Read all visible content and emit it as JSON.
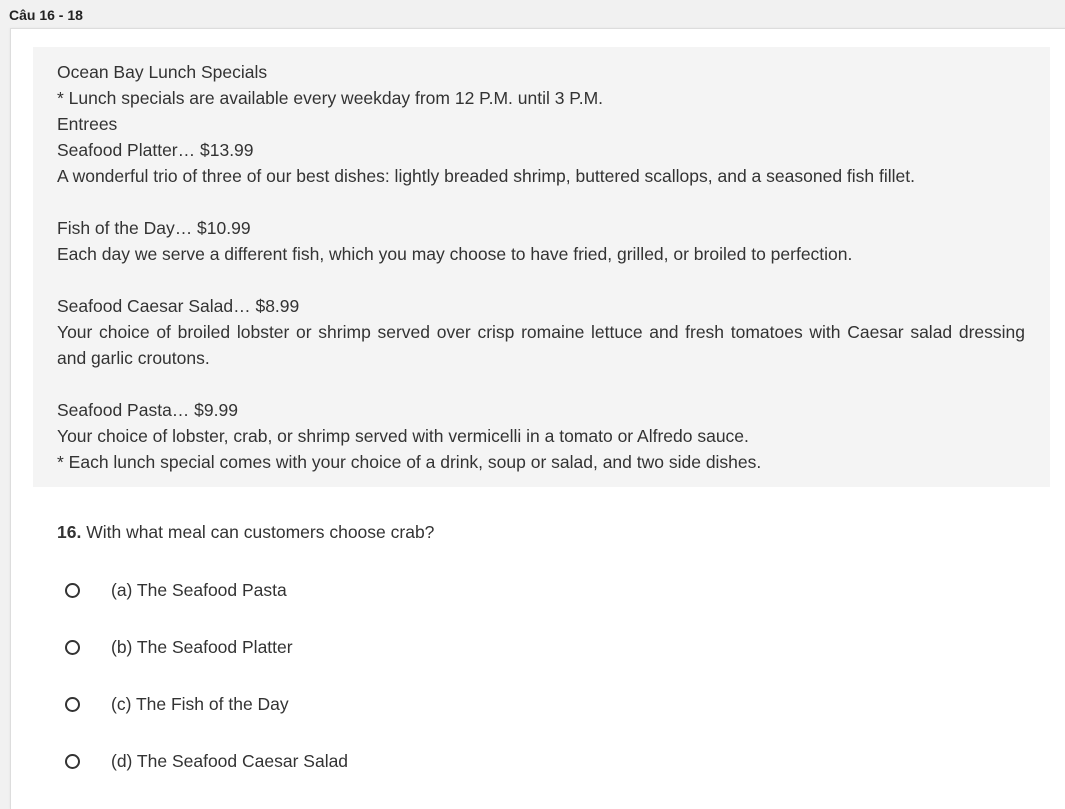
{
  "header": {
    "title": "Câu 16 - 18"
  },
  "passage": {
    "lines": [
      "Ocean Bay Lunch Specials",
      "* Lunch specials are available every weekday from 12 P.M. until 3 P.M.",
      "Entrees",
      "Seafood Platter… $13.99",
      "A wonderful trio of three of our best dishes: lightly breaded shrimp, buttered scallops, and a seasoned fish fillet.",
      "Fish of the Day… $10.99",
      "Each day we serve a different fish, which you may choose to have fried, grilled, or broiled to perfection.",
      "Seafood Caesar Salad… $8.99",
      "Your choice of broiled lobster or shrimp served over crisp romaine lettuce and fresh tomatoes with Caesar salad dressing and garlic croutons.",
      "Seafood Pasta… $9.99",
      "Your choice of lobster, crab, or shrimp served with vermicelli in a tomato or Alfredo sauce.",
      "* Each lunch special comes with your choice of a drink, soup or salad, and two side dishes."
    ]
  },
  "question": {
    "number": "16.",
    "text": "With what meal can customers choose crab?",
    "options": [
      {
        "label": "(a) The Seafood Pasta",
        "selected": false
      },
      {
        "label": "(b) The Seafood Platter",
        "selected": false
      },
      {
        "label": "(c) The Fish of the Day",
        "selected": false
      },
      {
        "label": "(d) The Seafood Caesar Salad",
        "selected": false
      }
    ]
  }
}
